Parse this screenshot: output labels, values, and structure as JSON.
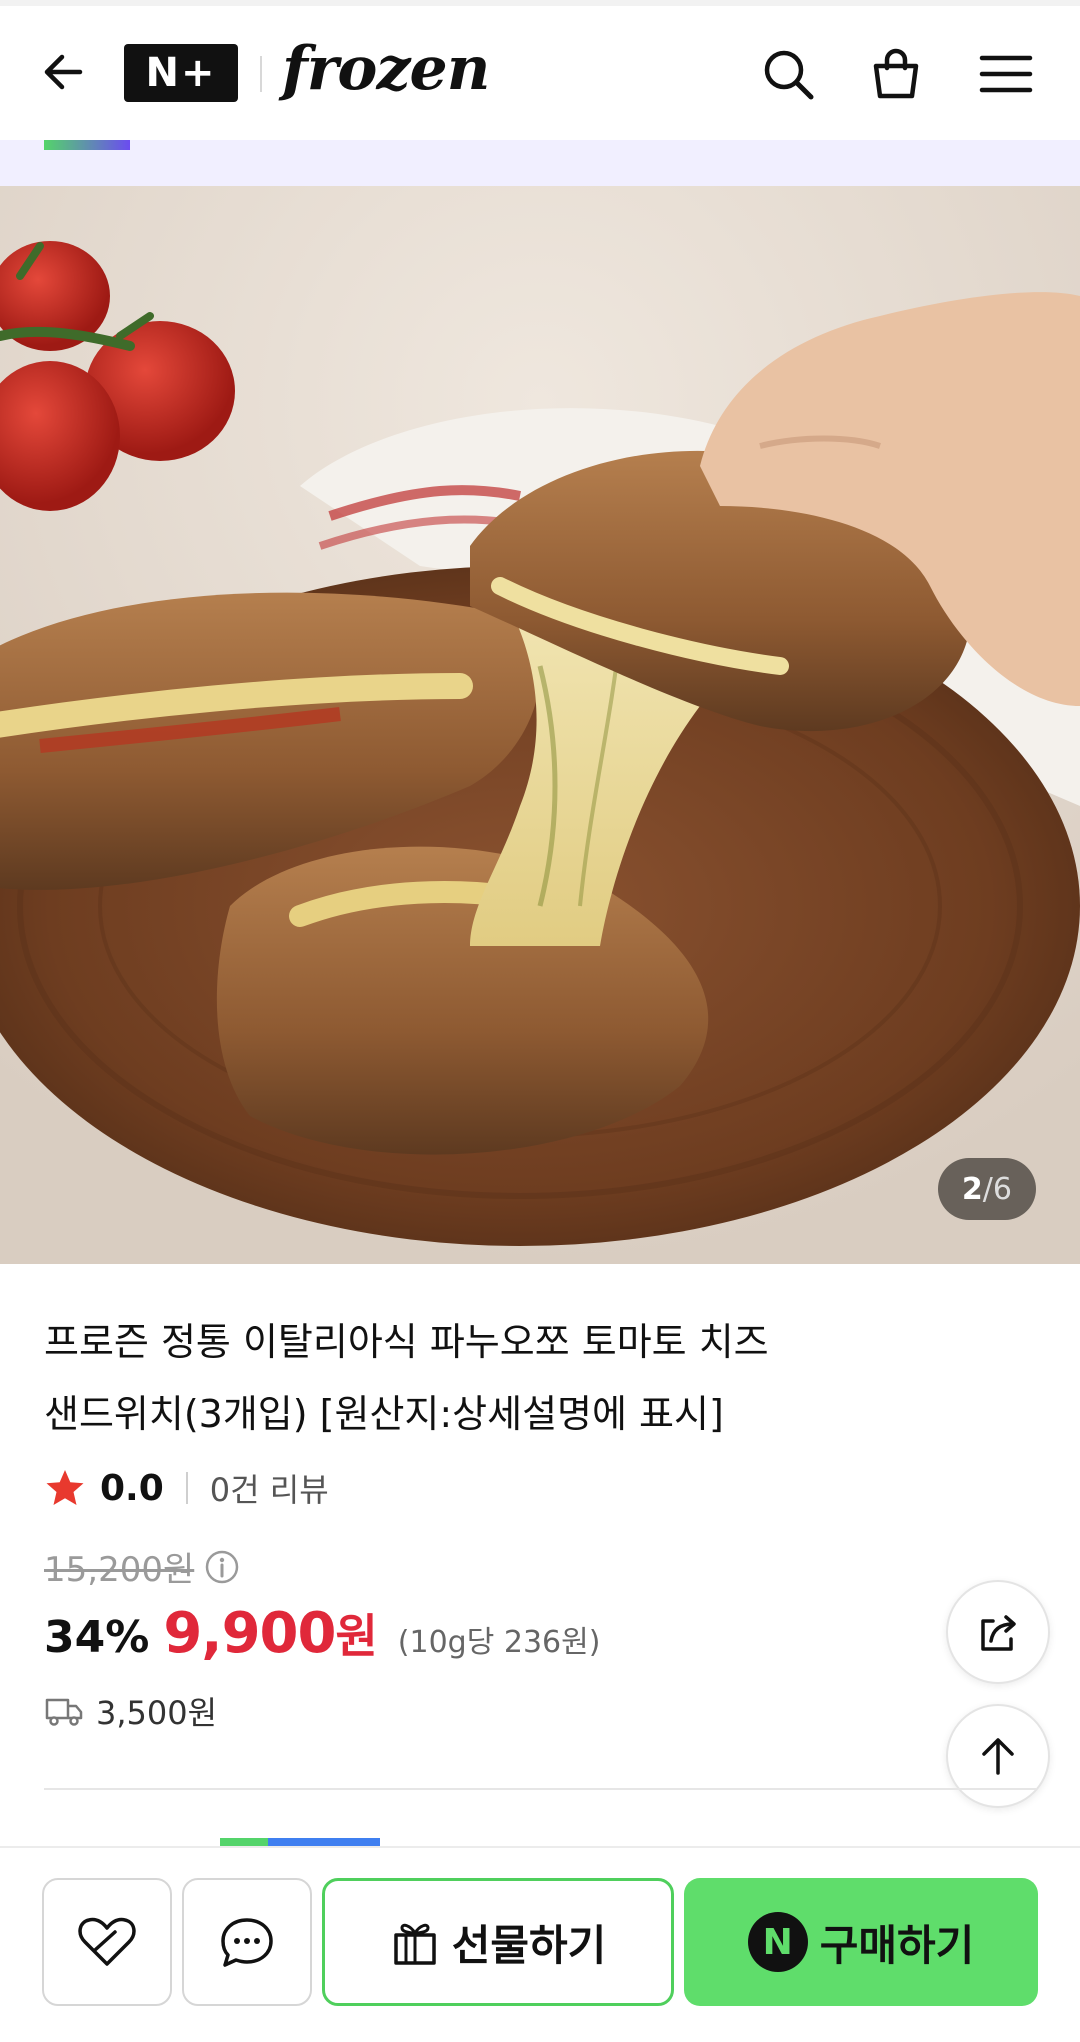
{
  "header": {
    "logo_text": "N+",
    "brand": "frozen",
    "icons": [
      "back-arrow-icon",
      "search-icon",
      "cart-icon",
      "hamburger-menu-icon"
    ]
  },
  "gallery": {
    "current": "2",
    "separator": "/",
    "total": "6"
  },
  "product": {
    "title_line1": "프로즌 정통 이탈리아식 파누오쪼 토마토 치즈",
    "title_line2": "샌드위치(3개입) [원산지:상세설명에 표시]",
    "rating": "0.0",
    "review_count": "0건 리뷰",
    "original_price": "15,200원",
    "discount_rate": "34%",
    "sale_price": "9,900",
    "sale_price_unit": "원",
    "unit_price": "(10g당 236원)",
    "shipping_fee": "3,500원"
  },
  "bottom_bar": {
    "gift_label": "선물하기",
    "buy_label": "구매하기",
    "buy_badge": "N"
  },
  "colors": {
    "sale_red": "#e0283a",
    "buy_green": "#5fdd6b",
    "gift_border_green": "#4fcf5c",
    "star_red": "#e8392e"
  }
}
